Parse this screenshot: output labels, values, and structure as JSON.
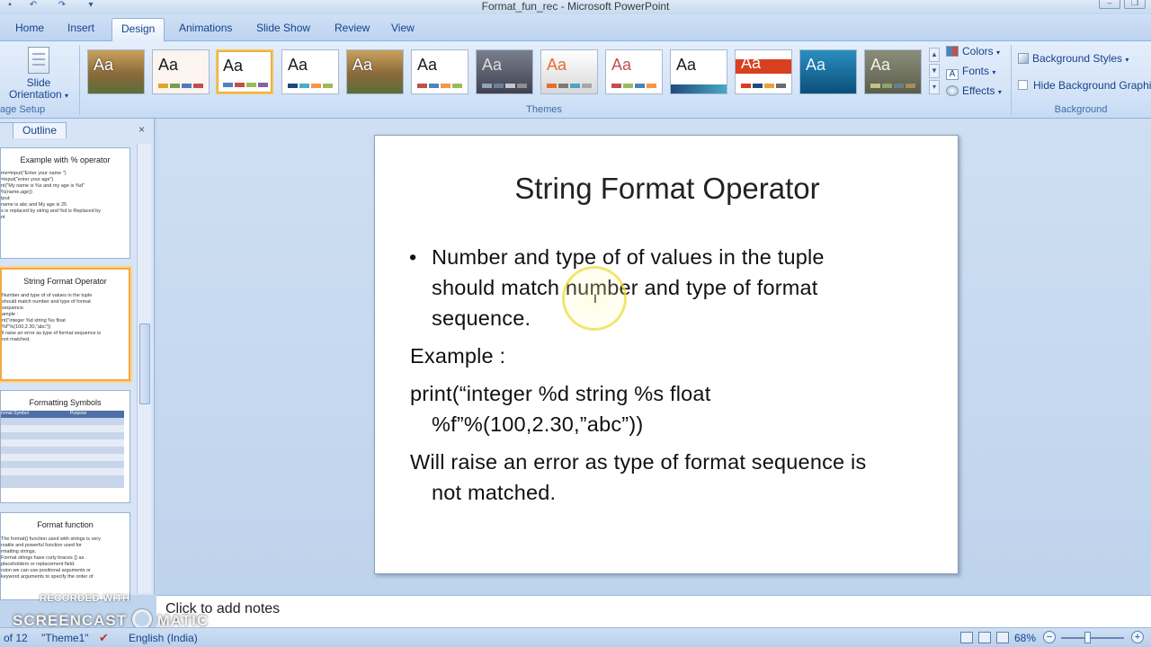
{
  "window": {
    "title": "Format_fun_rec - Microsoft PowerPoint"
  },
  "tabs": [
    {
      "label": "Home"
    },
    {
      "label": "Insert"
    },
    {
      "label": "Design"
    },
    {
      "label": "Animations"
    },
    {
      "label": "Slide Show"
    },
    {
      "label": "Review"
    },
    {
      "label": "View"
    }
  ],
  "ribbon": {
    "slide_orientation_line1": "Slide",
    "slide_orientation_line2": "Orientation",
    "page_setup_label": "age Setup",
    "themes_label": "Themes",
    "theme_sample": "Aa",
    "colors_label": "Colors",
    "fonts_label": "Fonts",
    "effects_label": "Effects",
    "background_styles_label": "Background Styles",
    "hide_background_label": "Hide Background Graphics",
    "background_label": "Background"
  },
  "left_pane": {
    "outline_tab": "Outline",
    "close": "×",
    "thumbnails": [
      {
        "title": "Example with % operator",
        "lines": [
          "me=input(\"Enter your name \")",
          "=input(\"enter your age\")",
          "nt(\"My name is %s and my age is %d\"",
          "%(name,age))",
          "tput:",
          " name is abc and My age is 25",
          "s is replaced by string and %d is Replaced by",
          "nt"
        ]
      },
      {
        "title": "String Format Operator",
        "lines": [
          "Number and type of of values in the tuple",
          "should match number and type of format",
          "sequence.",
          "ample :",
          "nt(\"integer  %d  string %s float",
          "%f\"%(100,2.30,\"abc\"))",
          "ll raise an error as type of format sequence is",
          "not matched."
        ]
      },
      {
        "title": "Formatting Symbols",
        "header": [
          "ormat Symbol",
          "Purpose"
        ]
      },
      {
        "title": "Format function",
        "lines": [
          "The format() function used with strings is very",
          "rsatile and powerful function used for",
          "rmatting strings.",
          "Format strings have curly braces {} as",
          "placeholders or replacement field.",
          "rsion we can use positional arguments or",
          "keyword arguments to specify the order of"
        ]
      }
    ]
  },
  "slide": {
    "title": "String Format Operator",
    "bullet": "•",
    "lines": [
      "Number and type of of values in the tuple",
      "should match number and type of format",
      "sequence.",
      "Example :",
      "print(“integer  %d  string %s float",
      "%f”%(100,2.30,”abc”))",
      "Will raise an error as type of format sequence is",
      "not matched."
    ]
  },
  "notes": {
    "placeholder": "Click to add notes"
  },
  "watermark": {
    "line1": "RECORDED WITH",
    "line2": "SCREENCAST",
    "line3": "MATIC"
  },
  "status": {
    "slide_info": "of 12",
    "theme": "\"Theme1\"",
    "language": "English (India)",
    "zoom": "68%"
  },
  "colors": {
    "accent": "#15428b",
    "selected_theme_border": "#f2c35a",
    "cursor_ring": "#f0dc3c"
  }
}
